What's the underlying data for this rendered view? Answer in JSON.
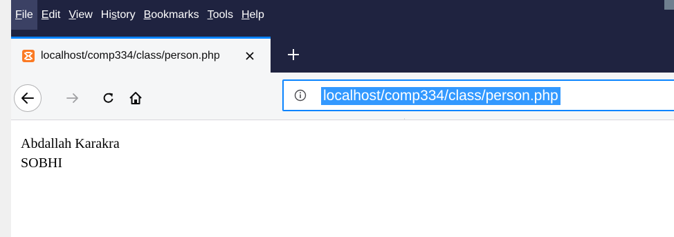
{
  "menu": {
    "items": [
      {
        "label": "File",
        "accel": "F",
        "rest": "ile"
      },
      {
        "label": "Edit",
        "accel": "E",
        "rest": "dit"
      },
      {
        "label": "View",
        "accel": "V",
        "rest": "iew"
      },
      {
        "label": "History",
        "pre": "Hi",
        "accel": "s",
        "rest": "tory"
      },
      {
        "label": "Bookmarks",
        "accel": "B",
        "rest": "ookmarks"
      },
      {
        "label": "Tools",
        "accel": "T",
        "rest": "ools"
      },
      {
        "label": "Help",
        "accel": "H",
        "rest": "elp"
      }
    ]
  },
  "tab": {
    "title": "localhost/comp334/class/person.php"
  },
  "urlbar": {
    "url": "localhost/comp334/class/person.php"
  },
  "page": {
    "line1": "Abdallah Karakra",
    "line2": "SOBHI"
  },
  "colors": {
    "chrome_dark": "#1f2340",
    "accent": "#0a84ff",
    "selection": "#3399ff",
    "favicon": "#fb7a24"
  }
}
